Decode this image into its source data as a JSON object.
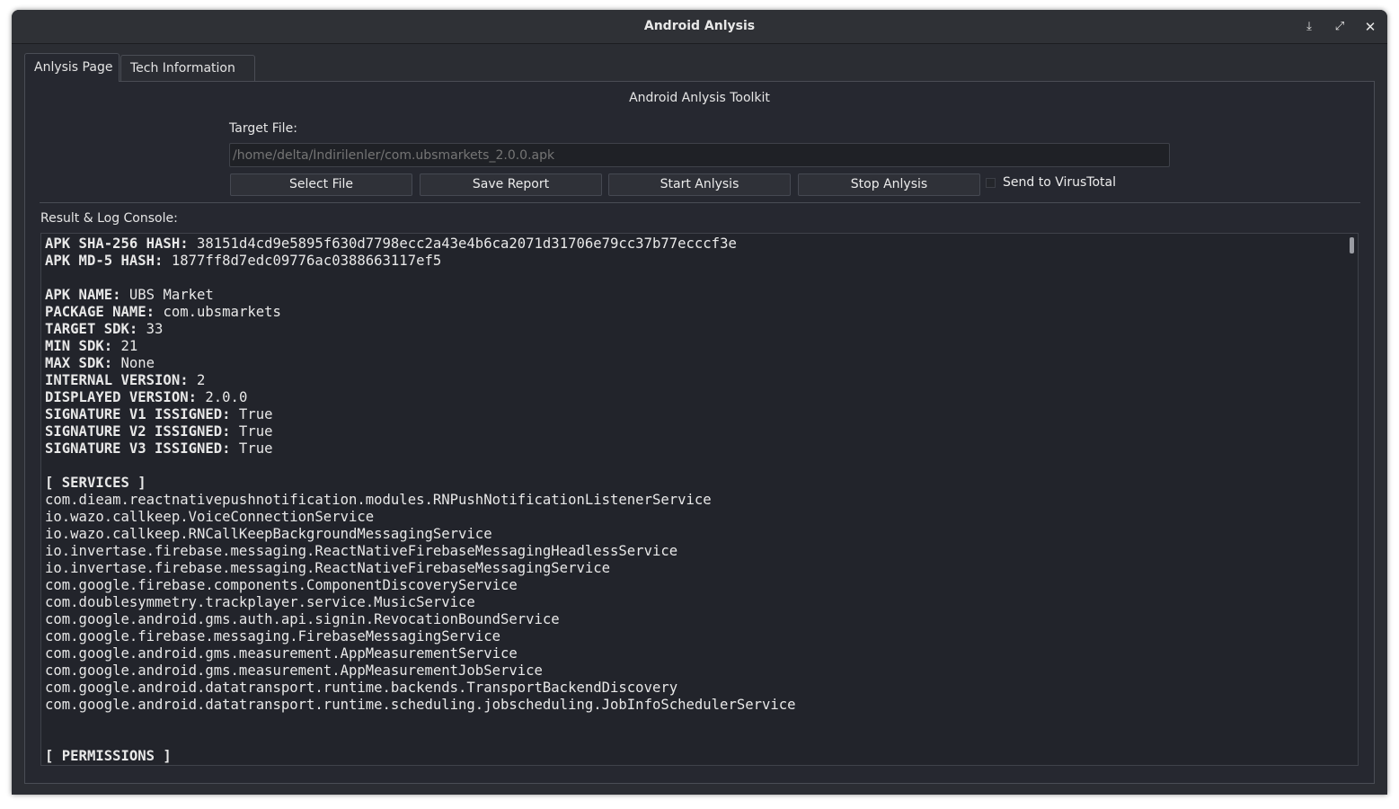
{
  "window": {
    "title": "Android Anlysis",
    "controls": {
      "minimize": "⤓",
      "maximize": "⤢",
      "close": "✕"
    }
  },
  "tabs": [
    {
      "label": "Anlysis Page",
      "active": true
    },
    {
      "label": "Tech Information",
      "active": false
    }
  ],
  "analysis": {
    "heading": "Android Anlysis Toolkit",
    "target_label": "Target File:",
    "target_placeholder": "/home/delta/İndirilenler/com.ubsmarkets_2.0.0.apk",
    "buttons": {
      "select_file": "Select File",
      "save_report": "Save Report",
      "start": "Start Anlysis",
      "stop": "Stop Anlysis"
    },
    "virustotal": {
      "label": "Send to VirusTotal",
      "checked": false
    },
    "console_label": "Result & Log Console:"
  },
  "console": {
    "lines": [
      {
        "key": "APK SHA-256 HASH:",
        "value": " 38151d4cd9e5895f630d7798ecc2a43e4b6ca2071d31706e79cc37b77ecccf3e"
      },
      {
        "key": "APK MD-5 HASH:",
        "value": " 1877ff8d7edc09776ac0388663117ef5"
      },
      {
        "key": "",
        "value": ""
      },
      {
        "key": "APK NAME:",
        "value": " UBS Market"
      },
      {
        "key": "PACKAGE NAME:",
        "value": " com.ubsmarkets"
      },
      {
        "key": "TARGET SDK:",
        "value": " 33"
      },
      {
        "key": "MIN SDK:",
        "value": " 21"
      },
      {
        "key": "MAX SDK:",
        "value": " None"
      },
      {
        "key": "INTERNAL VERSION:",
        "value": " 2"
      },
      {
        "key": "DISPLAYED VERSION:",
        "value": " 2.0.0"
      },
      {
        "key": "SIGNATURE V1 ISSIGNED:",
        "value": " True"
      },
      {
        "key": "SIGNATURE V2 ISSIGNED:",
        "value": " True"
      },
      {
        "key": "SIGNATURE V3 ISSIGNED:",
        "value": " True"
      },
      {
        "key": "",
        "value": ""
      },
      {
        "key": "[ SERVICES ]",
        "value": ""
      },
      {
        "key": "",
        "value": "com.dieam.reactnativepushnotification.modules.RNPushNotificationListenerService"
      },
      {
        "key": "",
        "value": "io.wazo.callkeep.VoiceConnectionService"
      },
      {
        "key": "",
        "value": "io.wazo.callkeep.RNCallKeepBackgroundMessagingService"
      },
      {
        "key": "",
        "value": "io.invertase.firebase.messaging.ReactNativeFirebaseMessagingHeadlessService"
      },
      {
        "key": "",
        "value": "io.invertase.firebase.messaging.ReactNativeFirebaseMessagingService"
      },
      {
        "key": "",
        "value": "com.google.firebase.components.ComponentDiscoveryService"
      },
      {
        "key": "",
        "value": "com.doublesymmetry.trackplayer.service.MusicService"
      },
      {
        "key": "",
        "value": "com.google.android.gms.auth.api.signin.RevocationBoundService"
      },
      {
        "key": "",
        "value": "com.google.firebase.messaging.FirebaseMessagingService"
      },
      {
        "key": "",
        "value": "com.google.android.gms.measurement.AppMeasurementService"
      },
      {
        "key": "",
        "value": "com.google.android.gms.measurement.AppMeasurementJobService"
      },
      {
        "key": "",
        "value": "com.google.android.datatransport.runtime.backends.TransportBackendDiscovery"
      },
      {
        "key": "",
        "value": "com.google.android.datatransport.runtime.scheduling.jobscheduling.JobInfoSchedulerService"
      },
      {
        "key": "",
        "value": ""
      },
      {
        "key": "",
        "value": ""
      },
      {
        "key": "[ PERMISSIONS ]",
        "value": ""
      }
    ]
  },
  "colors": {
    "window_bg": "#2b2d33",
    "pane_bg": "#262830",
    "console_bg": "#22242b",
    "text": "#e8e8e8",
    "placeholder": "#8c8f96"
  }
}
